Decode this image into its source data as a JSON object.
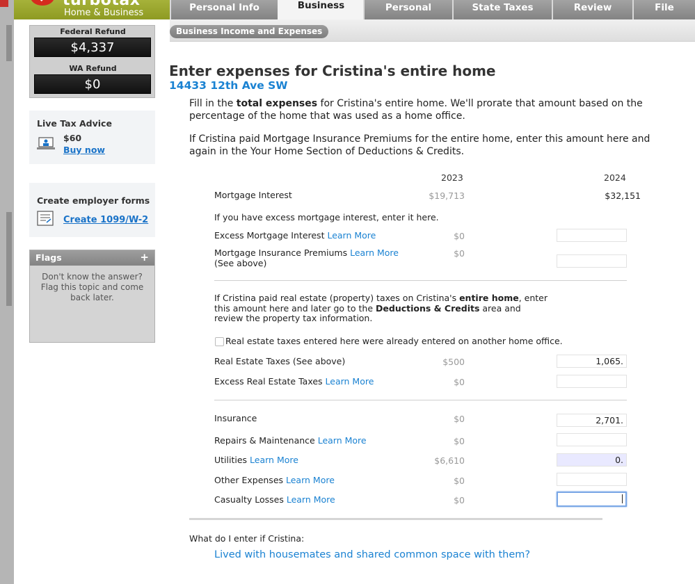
{
  "header": {
    "brand": "turbotax",
    "edition": "Home & Business",
    "tabs": [
      {
        "label": "Personal Info"
      },
      {
        "label": "Business"
      },
      {
        "label": "Personal"
      },
      {
        "label": "State Taxes"
      },
      {
        "label": "Review"
      },
      {
        "label": "File"
      }
    ],
    "active_tab": "Business",
    "subtab": "Business Income and Expenses"
  },
  "sidebar": {
    "federal_refund_label": "Federal Refund",
    "federal_refund_value": "$4,337",
    "state_refund_label": "WA Refund",
    "state_refund_value": "$0",
    "live_advice": {
      "title": "Live Tax Advice",
      "price": "$60",
      "link": "Buy now"
    },
    "employer_forms": {
      "title": "Create employer forms",
      "link": "Create 1099/W-2"
    },
    "flags": {
      "title": "Flags",
      "plus": "+",
      "text": "Don't know the answer? Flag this topic and come back later."
    }
  },
  "main": {
    "heading": "Enter expenses for Cristina's entire home",
    "address": "14433 12th Ave SW",
    "intro_pre": "Fill in the ",
    "intro_bold": "total expenses",
    "intro_post": " for Cristina's entire home. We'll prorate that amount based on the percentage of the home that was used as a home office.",
    "mortgage_note": "If Cristina paid Mortgage Insurance Premiums for the entire home, enter this amount here and again in the Your Home Section of Deductions & Credits.",
    "col_2023": "2023",
    "col_2024": "2024",
    "learn_more": "Learn More",
    "mortgage_interest": {
      "label": "Mortgage Interest",
      "v2023": "$19,713",
      "v2024": "$32,151"
    },
    "excess_note": "If you have excess mortgage interest, enter it here.",
    "excess_mortgage": {
      "label": "Excess Mortgage Interest ",
      "v2023": "$0",
      "v2024": ""
    },
    "mortgage_insurance": {
      "label": "Mortgage Insurance Premiums ",
      "label2": "(See above)",
      "v2023": "$0",
      "v2024": ""
    },
    "re_note_1": "If Cristina paid real estate (property) taxes on Cristina's ",
    "re_note_bold1": "entire home",
    "re_note_2": ", enter this amount here and later go to the ",
    "re_note_bold2": "Deductions & Credits",
    "re_note_3": " area and review the property tax information.",
    "checkbox_label": "Real estate taxes entered here were already entered on another home office.",
    "real_estate_taxes": {
      "label": "Real Estate Taxes (See above)",
      "v2023": "$500",
      "v2024": "1,065."
    },
    "excess_re_taxes": {
      "label": "Excess Real Estate Taxes ",
      "v2023": "$0",
      "v2024": ""
    },
    "insurance": {
      "label": "Insurance",
      "v2023": "$0",
      "v2024": "2,701."
    },
    "repairs": {
      "label": "Repairs & Maintenance ",
      "v2023": "$0",
      "v2024": ""
    },
    "utilities": {
      "label": "Utilities ",
      "v2023": "$6,610",
      "v2024": "0."
    },
    "other_expenses": {
      "label": "Other Expenses ",
      "v2023": "$0",
      "v2024": ""
    },
    "casualty_losses": {
      "label": "Casualty Losses ",
      "v2023": "$0",
      "v2024": ""
    },
    "question_title": "What do I enter if Cristina:",
    "question_link": "Lived with housemates and shared common space with them?"
  }
}
